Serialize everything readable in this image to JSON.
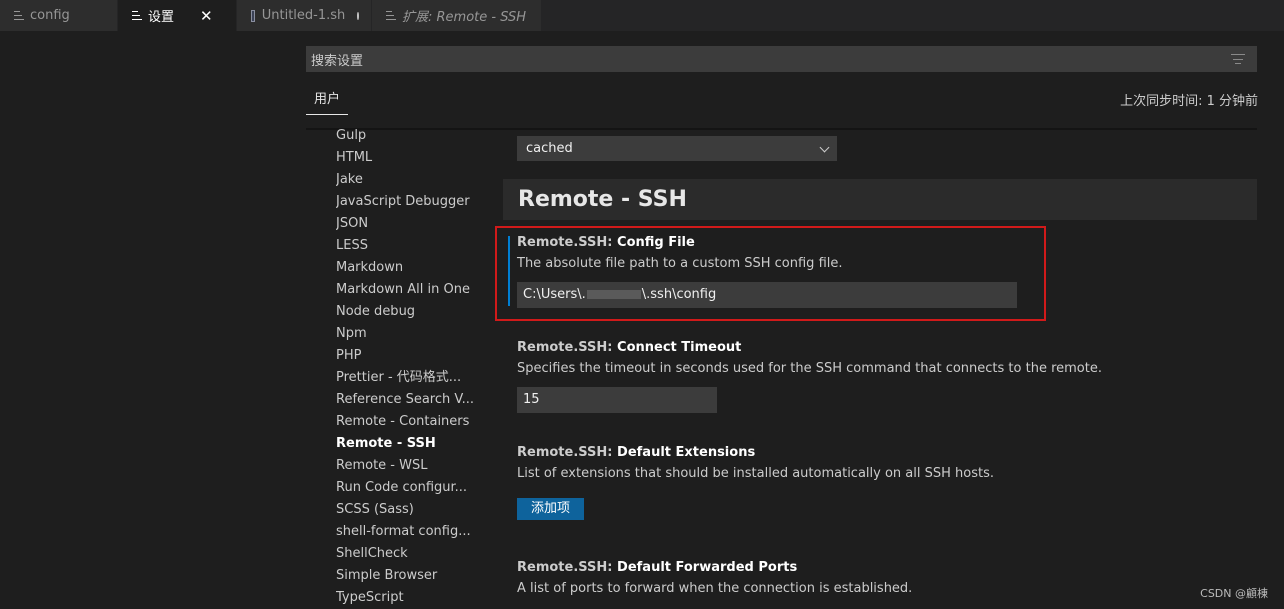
{
  "tabs": [
    {
      "label": "config",
      "icon": "lines-icon",
      "active": false
    },
    {
      "label": "设置",
      "icon": "lines-icon",
      "active": true
    },
    {
      "label": "Untitled-1.sh",
      "icon": "file-icon",
      "active": false,
      "dirty": true
    },
    {
      "label": "扩展: Remote - SSH",
      "icon": "extension-icon",
      "active": false
    }
  ],
  "search": {
    "placeholder": "搜索设置"
  },
  "scope": {
    "user_tab": "用户",
    "sync_status": "上次同步时间: 1 分钟前"
  },
  "toc": {
    "items": [
      "Gulp",
      "HTML",
      "Jake",
      "JavaScript Debugger",
      "JSON",
      "LESS",
      "Markdown",
      "Markdown All in One",
      "Node debug",
      "Npm",
      "PHP",
      "Prettier - 代码格式...",
      "Reference Search V...",
      "Remote - Containers",
      "Remote - SSH",
      "Remote - WSL",
      "Run Code configur...",
      "SCSS (Sass)",
      "shell-format config...",
      "ShellCheck",
      "Simple Browser",
      "TypeScript"
    ],
    "active": "Remote - SSH"
  },
  "main": {
    "top_select_value": "cached",
    "section_title": "Remote - SSH",
    "settings": [
      {
        "category": "Remote.SSH: ",
        "name": "Config File",
        "description": "The absolute file path to a custom SSH config file.",
        "value_prefix": "C:\\Users\\.",
        "value_suffix": "\\.ssh\\config"
      },
      {
        "category": "Remote.SSH: ",
        "name": "Connect Timeout",
        "description": "Specifies the timeout in seconds used for the SSH command that connects to the remote.",
        "value": "15"
      },
      {
        "category": "Remote.SSH: ",
        "name": "Default Extensions",
        "description": "List of extensions that should be installed automatically on all SSH hosts.",
        "button": "添加项"
      },
      {
        "category": "Remote.SSH: ",
        "name": "Default Forwarded Ports",
        "description": "A list of ports to forward when the connection is established."
      }
    ]
  },
  "watermark": "CSDN @顧棟",
  "colors": {
    "accent": "#0e639c",
    "focus": "#007fd4",
    "highlight": "#d11a1a",
    "background": "#1e1e1e"
  }
}
